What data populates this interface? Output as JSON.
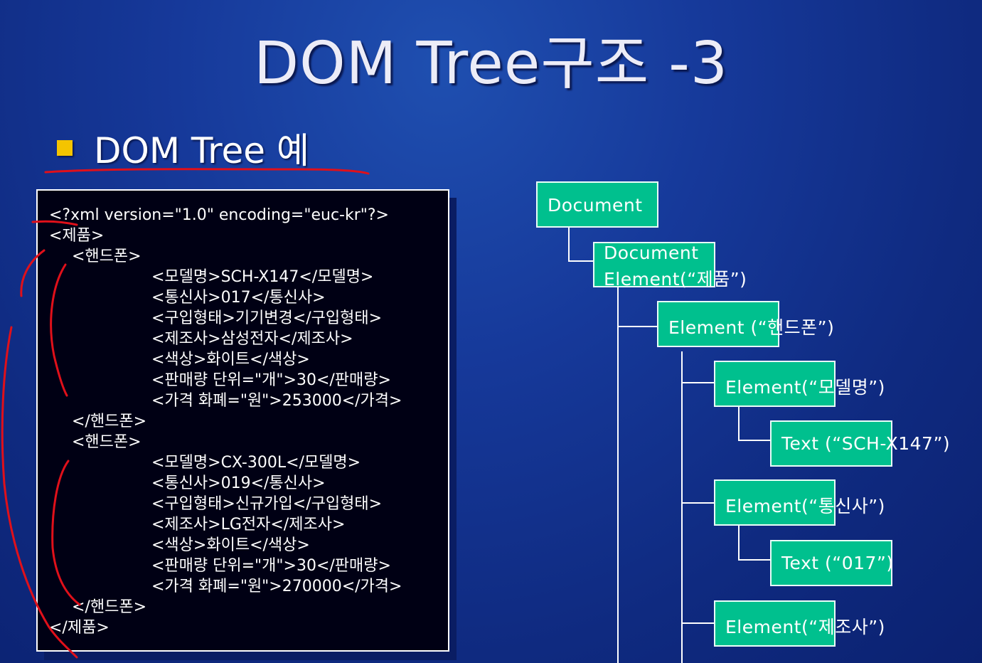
{
  "slide": {
    "title": "DOM Tree구조 -3",
    "bullet": "DOM Tree 예"
  },
  "code_lines": [
    {
      "indent": 0,
      "text": "<?xml version=\"1.0\" encoding=\"euc-kr\"?>"
    },
    {
      "indent": 0,
      "text": "<제품>"
    },
    {
      "indent": 1,
      "text": "<핸드폰>"
    },
    {
      "indent": 2,
      "text": "<모델명>SCH-X147</모델명>"
    },
    {
      "indent": 2,
      "text": "<통신사>017</통신사>"
    },
    {
      "indent": 2,
      "text": "<구입형태>기기변경</구입형태>"
    },
    {
      "indent": 2,
      "text": "<제조사>삼성전자</제조사>"
    },
    {
      "indent": 2,
      "text": "<색상>화이트</색상>"
    },
    {
      "indent": 2,
      "text": "<판매량 단위=\"개\">30</판매량>"
    },
    {
      "indent": 2,
      "text": "<가격 화폐=\"원\">253000</가격>"
    },
    {
      "indent": 1,
      "text": "</핸드폰>"
    },
    {
      "indent": 1,
      "text": "<핸드폰>"
    },
    {
      "indent": 2,
      "text": "<모델명>CX-300L</모델명>"
    },
    {
      "indent": 2,
      "text": "<통신사>019</통신사>"
    },
    {
      "indent": 2,
      "text": "<구입형태>신규가입</구입형태>"
    },
    {
      "indent": 2,
      "text": "<제조사>LG전자</제조사>"
    },
    {
      "indent": 2,
      "text": "<색상>화이트</색상>"
    },
    {
      "indent": 2,
      "text": "<판매량 단위=\"개\">30</판매량>"
    },
    {
      "indent": 2,
      "text": "<가격 화폐=\"원\">270000</가격>"
    },
    {
      "indent": 1,
      "text": "</핸드폰>"
    },
    {
      "indent": 0,
      "text": "</제품>"
    }
  ],
  "tree_nodes": {
    "document": {
      "text": "Document"
    },
    "document_element": {
      "line1": "Document",
      "line2": "Element(“제품”)"
    },
    "element_handphone": {
      "text": "Element (“핸드폰”)"
    },
    "element_model": {
      "text": "Element(“모델명”)"
    },
    "text_model": {
      "text": "Text (“SCH-X147”)"
    },
    "element_carrier": {
      "text": "Element(“통신사”)"
    },
    "text_carrier": {
      "text": "Text (“017”)"
    },
    "element_maker": {
      "text": "Element(“제조사”)"
    }
  },
  "colors": {
    "background": "#16399a",
    "node_fill": "#00c08e",
    "bullet": "#f4c400",
    "annotation_ink": "#e0101a"
  }
}
